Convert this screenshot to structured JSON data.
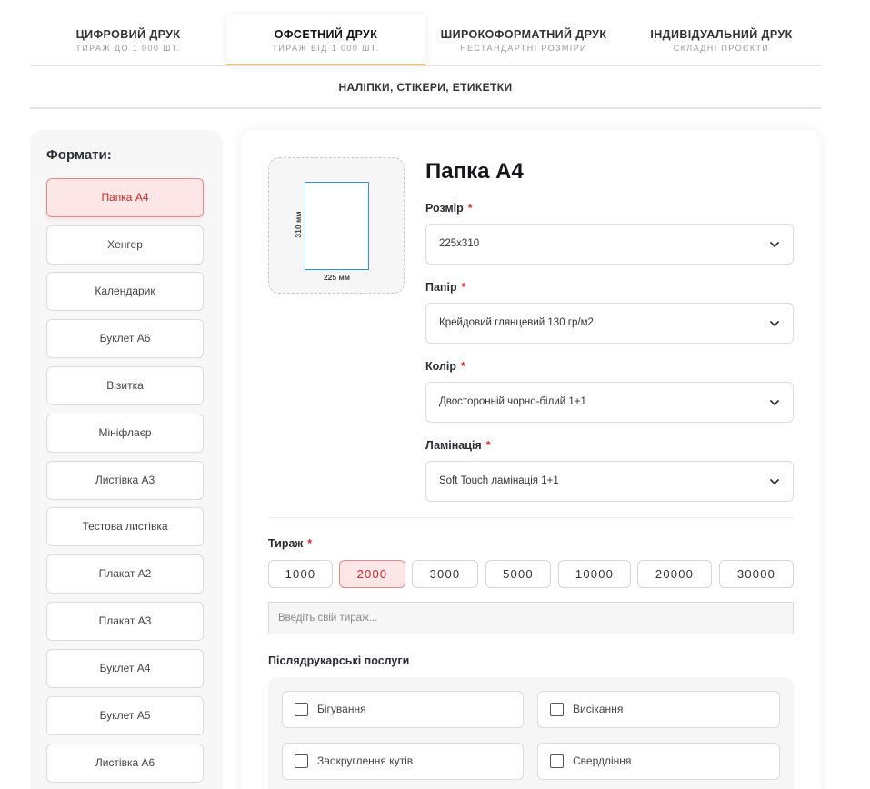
{
  "tabs": [
    {
      "title": "ЦИФРОВИЙ ДРУК",
      "subtitle": "ТИРАЖ ДО 1 000 ШТ."
    },
    {
      "title": "ОФСЕТНИЙ ДРУК",
      "subtitle": "ТИРАЖ ВІД 1 000 ШТ.",
      "active": true
    },
    {
      "title": "ШИРОКОФОРМАТНИЙ ДРУК",
      "subtitle": "НЕСТАНДАРТНІ РОЗМІРИ"
    },
    {
      "title": "ІНДИВІДУАЛЬНИЙ ДРУК",
      "subtitle": "СКЛАДНІ ПРОЄКТИ"
    }
  ],
  "sub_tab": "НАЛІПКИ, СТІКЕРИ, ЕТИКЕТКИ",
  "sidebar": {
    "title": "Формати:",
    "items": [
      {
        "label": "Папка А4",
        "active": true
      },
      {
        "label": "Хенгер"
      },
      {
        "label": "Календарик"
      },
      {
        "label": "Буклет А6"
      },
      {
        "label": "Візитка"
      },
      {
        "label": "Мініфлаєр"
      },
      {
        "label": "Листівка А3"
      },
      {
        "label": "Тестова листівка"
      },
      {
        "label": "Плакат А2"
      },
      {
        "label": "Плакат А3"
      },
      {
        "label": "Буклет А4"
      },
      {
        "label": "Буклет А5"
      },
      {
        "label": "Листівка А6"
      }
    ]
  },
  "product": {
    "title": "Папка А4",
    "preview": {
      "width_label": "225 мм",
      "height_label": "310 мм"
    }
  },
  "fields": [
    {
      "label": "Розмір",
      "value": "225x310"
    },
    {
      "label": "Папір",
      "value": "Крейдовий глянцевий 130 гр/м2"
    },
    {
      "label": "Колір",
      "value": "Двосторонній чорно-білий 1+1"
    },
    {
      "label": "Ламінація",
      "value": "Soft Touch ламінація 1+1"
    }
  ],
  "required_mark": "*",
  "quantity": {
    "label": "Тираж",
    "options": [
      "1000",
      "2000",
      "3000",
      "5000",
      "10000",
      "20000",
      "30000"
    ],
    "selected": "2000",
    "placeholder": "Введіть свій тираж..."
  },
  "services": {
    "label": "Післядрукарські послуги",
    "items": [
      "Бігування",
      "Висікання",
      "Заокруглення кутів",
      "Свердління"
    ]
  },
  "colors": {
    "accent_yellow": "#f3cc2c",
    "active_red": "#c92a2a",
    "active_bg": "#fde6e6",
    "preview_border": "#2e8fd6"
  }
}
